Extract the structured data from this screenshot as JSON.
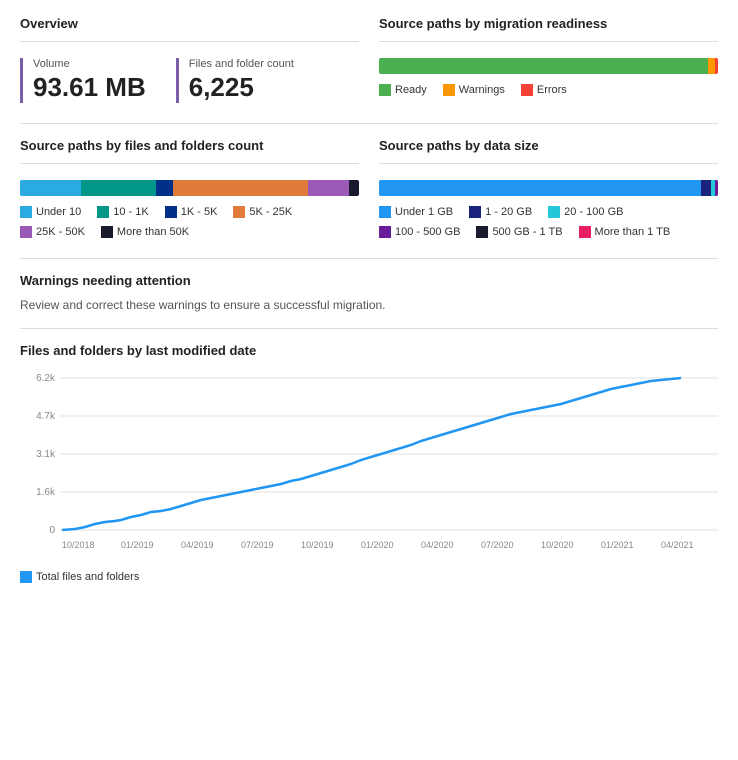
{
  "overview": {
    "title": "Overview",
    "volume_label": "Volume",
    "volume_value": "93.61 MB",
    "files_label": "Files and folder count",
    "files_value": "6,225"
  },
  "readiness": {
    "title": "Source paths by migration readiness",
    "bar": [
      {
        "color": "#4CAF50",
        "pct": 97
      },
      {
        "color": "#FF9800",
        "pct": 2
      },
      {
        "color": "#F44336",
        "pct": 1
      }
    ],
    "legend": [
      {
        "label": "Ready",
        "color": "#4CAF50"
      },
      {
        "label": "Warnings",
        "color": "#FF9800"
      },
      {
        "label": "Errors",
        "color": "#F44336"
      }
    ]
  },
  "files_folders_count": {
    "title": "Source paths by files and folders count",
    "bar": [
      {
        "color": "#29ABE2",
        "pct": 18
      },
      {
        "color": "#009688",
        "pct": 22
      },
      {
        "color": "#003087",
        "pct": 5
      },
      {
        "color": "#E07B3A",
        "pct": 40
      },
      {
        "color": "#9B59B6",
        "pct": 12
      },
      {
        "color": "#1A1A2E",
        "pct": 3
      }
    ],
    "legend": [
      {
        "label": "Under 10",
        "color": "#29ABE2"
      },
      {
        "label": "10 - 1K",
        "color": "#009688"
      },
      {
        "label": "1K - 5K",
        "color": "#003087"
      },
      {
        "label": "5K - 25K",
        "color": "#E07B3A"
      },
      {
        "label": "25K - 50K",
        "color": "#9B59B6"
      },
      {
        "label": "More than 50K",
        "color": "#1A1A2E"
      }
    ]
  },
  "data_size": {
    "title": "Source paths by data size",
    "bar": [
      {
        "color": "#2196F3",
        "pct": 95
      },
      {
        "color": "#1A237E",
        "pct": 3
      },
      {
        "color": "#26C6DA",
        "pct": 1
      },
      {
        "color": "#6A1B9A",
        "pct": 1
      }
    ],
    "legend": [
      {
        "label": "Under 1 GB",
        "color": "#2196F3"
      },
      {
        "label": "1 - 20 GB",
        "color": "#1A237E"
      },
      {
        "label": "20 - 100 GB",
        "color": "#26C6DA"
      },
      {
        "label": "100 - 500 GB",
        "color": "#6A1B9A"
      },
      {
        "label": "500 GB - 1 TB",
        "color": "#1A1A2E"
      },
      {
        "label": "More than 1 TB",
        "color": "#E91E63"
      }
    ]
  },
  "warnings": {
    "title": "Warnings needing attention",
    "description": "Review and correct these warnings to ensure a successful migration."
  },
  "chart": {
    "title": "Files and folders by last modified date",
    "y_labels": [
      "6.2k",
      "4.7k",
      "3.1k",
      "1.6k",
      "0"
    ],
    "x_labels": [
      "10/2018",
      "01/2019",
      "04/2019",
      "07/2019",
      "10/2019",
      "01/2020",
      "04/2020",
      "07/2020",
      "10/2020",
      "01/2021",
      "04/2021"
    ],
    "legend_label": "Total files and folders",
    "legend_color": "#2196F3"
  }
}
